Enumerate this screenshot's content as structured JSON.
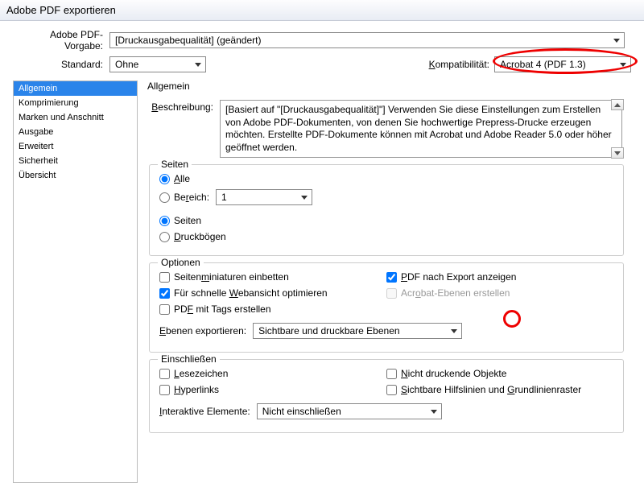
{
  "window_title": "Adobe PDF exportieren",
  "preset": {
    "label": "Adobe PDF-Vorgabe:",
    "value": "[Druckausgabequalität] (geändert)"
  },
  "standard": {
    "label": "Standard:",
    "value": "Ohne"
  },
  "compat": {
    "label": "Kompatibilität:",
    "value": "Acrobat 4 (PDF 1.3)"
  },
  "sidebar": {
    "items": [
      "Allgemein",
      "Komprimierung",
      "Marken und Anschnitt",
      "Ausgabe",
      "Erweitert",
      "Sicherheit",
      "Übersicht"
    ],
    "active_index": 0
  },
  "panel_heading": "Allgemein",
  "description": {
    "label": "Beschreibung:",
    "text": "[Basiert auf \"[Druckausgabequalität]\"] Verwenden Sie diese Einstellungen zum Erstellen von Adobe PDF-Dokumenten, von denen Sie hochwertige Prepress-Drucke erzeugen möchten. Erstellte PDF-Dokumente können mit Acrobat und Adobe Reader 5.0 oder höher geöffnet werden."
  },
  "pages_group": {
    "title": "Seiten",
    "all": "Alle",
    "range": "Bereich:",
    "range_value": "1",
    "pages": "Seiten",
    "spreads": "Druckbögen"
  },
  "options_group": {
    "title": "Optionen",
    "thumbnails": "Seitenminiaturen einbetten",
    "view_after": "PDF nach Export anzeigen",
    "fast_web": "Für schnelle Webansicht optimieren",
    "acrobat_layers": "Acrobat-Ebenen erstellen",
    "tagged": "PDF mit Tags erstellen",
    "export_layers_label": "Ebenen exportieren:",
    "export_layers_value": "Sichtbare und druckbare Ebenen"
  },
  "include_group": {
    "title": "Einschließen",
    "bookmarks": "Lesezeichen",
    "nonprinting": "Nicht druckende Objekte",
    "hyperlinks": "Hyperlinks",
    "guides": "Sichtbare Hilfslinien und Grundlinienraster",
    "interactive_label": "Interaktive Elemente:",
    "interactive_value": "Nicht einschließen"
  }
}
